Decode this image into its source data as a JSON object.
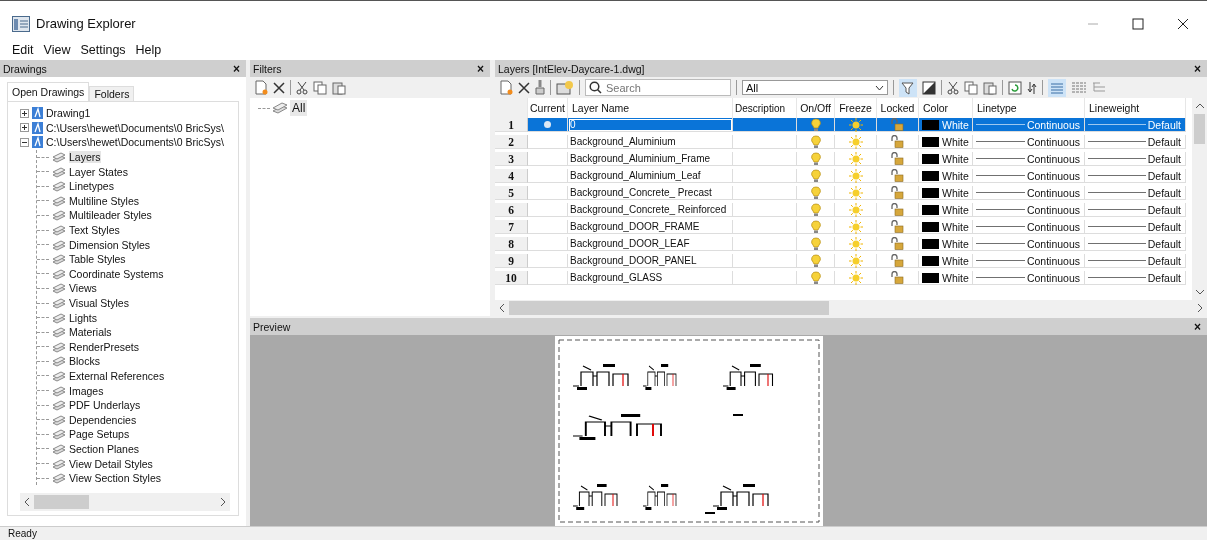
{
  "window": {
    "title": "Drawing Explorer"
  },
  "menu": [
    "Edit",
    "View",
    "Settings",
    "Help"
  ],
  "drawings_panel": {
    "title": "Drawings",
    "close": "×",
    "tabs": [
      {
        "label": "Open Drawings",
        "selected": true
      },
      {
        "label": "Folders",
        "selected": false
      }
    ],
    "tree": [
      {
        "label": "Drawing1",
        "expanded": false
      },
      {
        "label": "C:\\Users\\hewet\\Documents\\0 BricSys\\",
        "expanded": false
      },
      {
        "label": "C:\\Users\\hewet\\Documents\\0 BricSys\\",
        "expanded": true,
        "children": [
          {
            "label": "Layers",
            "selected": true
          },
          {
            "label": "Layer States",
            "selected": false
          },
          {
            "label": "Linetypes",
            "selected": false
          },
          {
            "label": "Multiline Styles",
            "selected": false
          },
          {
            "label": "Multileader Styles",
            "selected": false
          },
          {
            "label": "Text Styles",
            "selected": false
          },
          {
            "label": "Dimension Styles",
            "selected": false
          },
          {
            "label": "Table Styles",
            "selected": false
          },
          {
            "label": "Coordinate Systems",
            "selected": false
          },
          {
            "label": "Views",
            "selected": false
          },
          {
            "label": "Visual Styles",
            "selected": false
          },
          {
            "label": "Lights",
            "selected": false
          },
          {
            "label": "Materials",
            "selected": false
          },
          {
            "label": "RenderPresets",
            "selected": false
          },
          {
            "label": "Blocks",
            "selected": false
          },
          {
            "label": "External References",
            "selected": false
          },
          {
            "label": "Images",
            "selected": false
          },
          {
            "label": "PDF Underlays",
            "selected": false
          },
          {
            "label": "Dependencies",
            "selected": false
          },
          {
            "label": "Page Setups",
            "selected": false
          },
          {
            "label": "Section Planes",
            "selected": false
          },
          {
            "label": "View Detail Styles",
            "selected": false
          },
          {
            "label": "View Section Styles",
            "selected": false
          }
        ]
      }
    ]
  },
  "filters_panel": {
    "title": "Filters",
    "close": "×",
    "items": [
      {
        "label": "All",
        "selected": true
      }
    ]
  },
  "layers_panel": {
    "title": "Layers [IntElev-Daycare-1.dwg]",
    "close": "×",
    "search": {
      "placeholder": "Search"
    },
    "filter": {
      "value": "All"
    },
    "columns": [
      "Current",
      "Layer Name",
      "Description",
      "On/Off",
      "Freeze",
      "Locked",
      "Color",
      "Linetype",
      "Lineweight"
    ],
    "rows": [
      {
        "number": "1",
        "current": true,
        "name": "0",
        "on": true,
        "frozen": false,
        "locked": false,
        "color": "#000000",
        "color_name": "White",
        "linetype": "Continuous",
        "lineweight": "Default",
        "selected": true
      },
      {
        "number": "2",
        "current": false,
        "name": "Background_Aluminium",
        "on": true,
        "frozen": false,
        "locked": false,
        "color": "#000000",
        "color_name": "White",
        "linetype": "Continuous",
        "lineweight": "Default",
        "selected": false
      },
      {
        "number": "3",
        "current": false,
        "name": "Background_Aluminium_Frame",
        "on": true,
        "frozen": false,
        "locked": false,
        "color": "#000000",
        "color_name": "White",
        "linetype": "Continuous",
        "lineweight": "Default",
        "selected": false
      },
      {
        "number": "4",
        "current": false,
        "name": "Background_Aluminium_Leaf",
        "on": true,
        "frozen": false,
        "locked": false,
        "color": "#000000",
        "color_name": "White",
        "linetype": "Continuous",
        "lineweight": "Default",
        "selected": false
      },
      {
        "number": "5",
        "current": false,
        "name": "Background_Concrete_ Precast",
        "on": true,
        "frozen": false,
        "locked": false,
        "color": "#000000",
        "color_name": "White",
        "linetype": "Continuous",
        "lineweight": "Default",
        "selected": false
      },
      {
        "number": "6",
        "current": false,
        "name": "Background_Concrete_ Reinforced",
        "on": true,
        "frozen": false,
        "locked": false,
        "color": "#000000",
        "color_name": "White",
        "linetype": "Continuous",
        "lineweight": "Default",
        "selected": false
      },
      {
        "number": "7",
        "current": false,
        "name": "Background_DOOR_FRAME",
        "on": true,
        "frozen": false,
        "locked": false,
        "color": "#000000",
        "color_name": "White",
        "linetype": "Continuous",
        "lineweight": "Default",
        "selected": false
      },
      {
        "number": "8",
        "current": false,
        "name": "Background_DOOR_LEAF",
        "on": true,
        "frozen": false,
        "locked": false,
        "color": "#000000",
        "color_name": "White",
        "linetype": "Continuous",
        "lineweight": "Default",
        "selected": false
      },
      {
        "number": "9",
        "current": false,
        "name": "Background_DOOR_PANEL",
        "on": true,
        "frozen": false,
        "locked": false,
        "color": "#000000",
        "color_name": "White",
        "linetype": "Continuous",
        "lineweight": "Default",
        "selected": false
      },
      {
        "number": "10",
        "current": false,
        "name": "Background_GLASS",
        "on": true,
        "frozen": false,
        "locked": false,
        "color": "#000000",
        "color_name": "White",
        "linetype": "Continuous",
        "lineweight": "Default",
        "selected": false
      }
    ]
  },
  "preview_panel": {
    "title": "Preview",
    "close": "×"
  },
  "status_bar": {
    "text": "Ready"
  }
}
